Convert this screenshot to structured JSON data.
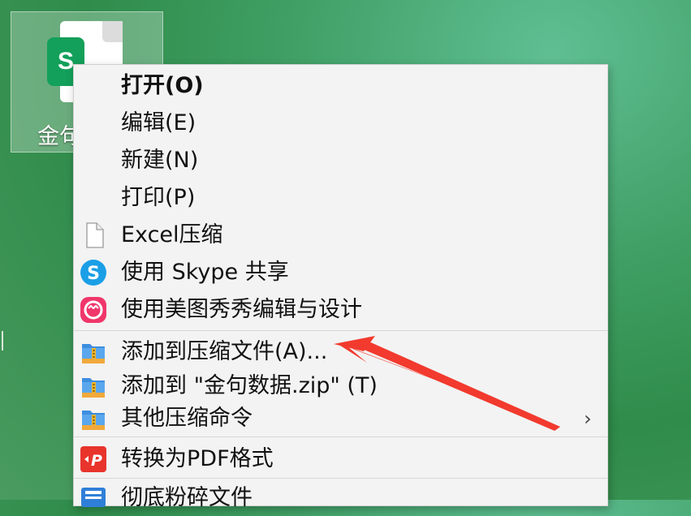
{
  "desktop": {
    "file_icon_letter": "S",
    "file_label": "金句"
  },
  "menu": {
    "items": [
      {
        "label": "打开(O)",
        "bold": true,
        "icon": "none"
      },
      {
        "label": "编辑(E)",
        "icon": "none"
      },
      {
        "label": "新建(N)",
        "icon": "none"
      },
      {
        "label": "打印(P)",
        "icon": "none"
      },
      {
        "label": "Excel压缩",
        "icon": "blank-document-icon"
      },
      {
        "label": "使用 Skype 共享",
        "icon": "skype-icon"
      },
      {
        "label": "使用美图秀秀编辑与设计",
        "icon": "meitu-icon"
      },
      {
        "label": "添加到压缩文件(A)...",
        "icon": "archive-icon"
      },
      {
        "label": "添加到 \"金句数据.zip\" (T)",
        "icon": "archive-icon"
      },
      {
        "label": "其他压缩命令",
        "icon": "archive-icon",
        "submenu_indicator": "›"
      },
      {
        "label": "转换为PDF格式",
        "icon": "pdf-convert-icon"
      },
      {
        "label": "彻底粉碎文件",
        "icon": "shredder-icon"
      }
    ]
  },
  "colors": {
    "annotation_arrow": "#f23a2e",
    "excel_green": "#13a05a",
    "skype_blue": "#1a9fe6",
    "meitu_pink": "#f0366a",
    "pdf_red": "#e8342b"
  }
}
